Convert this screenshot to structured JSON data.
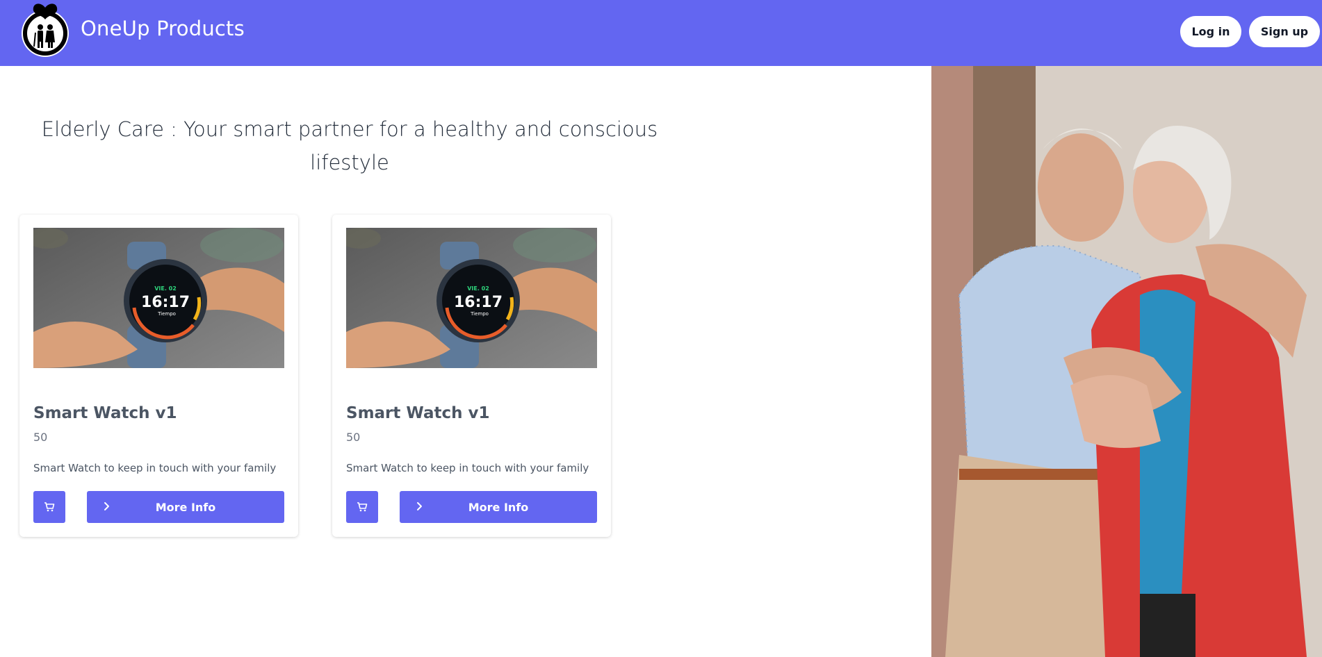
{
  "header": {
    "brand": "OneUp Products",
    "login_label": "Log in",
    "signup_label": "Sign up"
  },
  "hero": {
    "tagline": "Elderly Care : Your smart partner for a healthy and conscious lifestyle"
  },
  "products": [
    {
      "title": "Smart Watch v1",
      "price": "50",
      "description": "Smart Watch to keep in touch with your family",
      "watch_time": "16:17",
      "watch_date": "VIE. 02",
      "watch_weather": "Tiempo",
      "more_info_label": "More Info"
    },
    {
      "title": "Smart Watch v1",
      "price": "50",
      "description": "Smart Watch to keep in touch with your family",
      "watch_time": "16:17",
      "watch_date": "VIE. 02",
      "watch_weather": "Tiempo",
      "more_info_label": "More Info"
    }
  ],
  "colors": {
    "brand": "#6366f1",
    "text_dark": "#1f2937",
    "text_muted": "#6b7280"
  },
  "icons": [
    "logo-icon",
    "cart-icon",
    "chevron-right-icon"
  ]
}
